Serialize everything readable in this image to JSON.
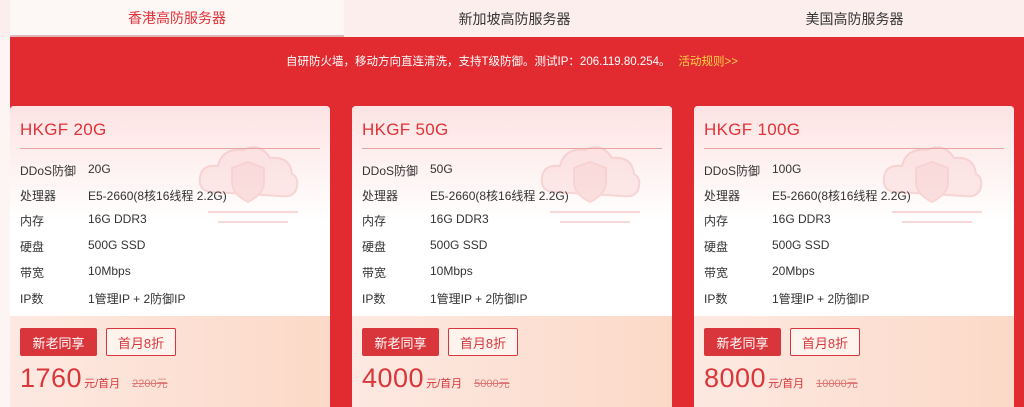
{
  "tabs": [
    {
      "label": "香港高防服务器",
      "active": true
    },
    {
      "label": "新加坡高防服务器",
      "active": false
    },
    {
      "label": "美国高防服务器",
      "active": false
    }
  ],
  "notice": {
    "text": "自研防火墙，移动方向直连清洗，支持T级防御。测试IP：206.119.80.254。",
    "link": "活动规则>>"
  },
  "spec_labels": {
    "ddos": "DDoS防御",
    "cpu": "处理器",
    "ram": "内存",
    "disk": "硬盘",
    "bw": "带宽",
    "ip": "IP数"
  },
  "cards": [
    {
      "title": "HKGF 20G",
      "ddos": "20G",
      "cpu": "E5-2660(8核16线程 2.2G)",
      "ram": "16G DDR3",
      "disk": "500G SSD",
      "bw": "10Mbps",
      "ip": "1管理IP + 2防御IP",
      "badge": "新老同享",
      "discount": "首月8折",
      "price": "1760",
      "unit": "元/首月",
      "old_price": "2200元"
    },
    {
      "title": "HKGF 50G",
      "ddos": "50G",
      "cpu": "E5-2660(8核16线程 2.2G)",
      "ram": "16G DDR3",
      "disk": "500G SSD",
      "bw": "10Mbps",
      "ip": "1管理IP + 2防御IP",
      "badge": "新老同享",
      "discount": "首月8折",
      "price": "4000",
      "unit": "元/首月",
      "old_price": "5000元"
    },
    {
      "title": "HKGF 100G",
      "ddos": "100G",
      "cpu": "E5-2660(8核16线程 2.2G)",
      "ram": "16G DDR3",
      "disk": "500G SSD",
      "bw": "20Mbps",
      "ip": "1管理IP + 2防御IP",
      "badge": "新老同享",
      "discount": "首月8折",
      "price": "8000",
      "unit": "元/首月",
      "old_price": "10000元"
    }
  ],
  "colors": {
    "brand_red": "#e22b31",
    "accent_red": "#d9363b",
    "link_yellow": "#ffd24a"
  },
  "icons": {
    "card_decoration": "cloud-shield-icon"
  }
}
